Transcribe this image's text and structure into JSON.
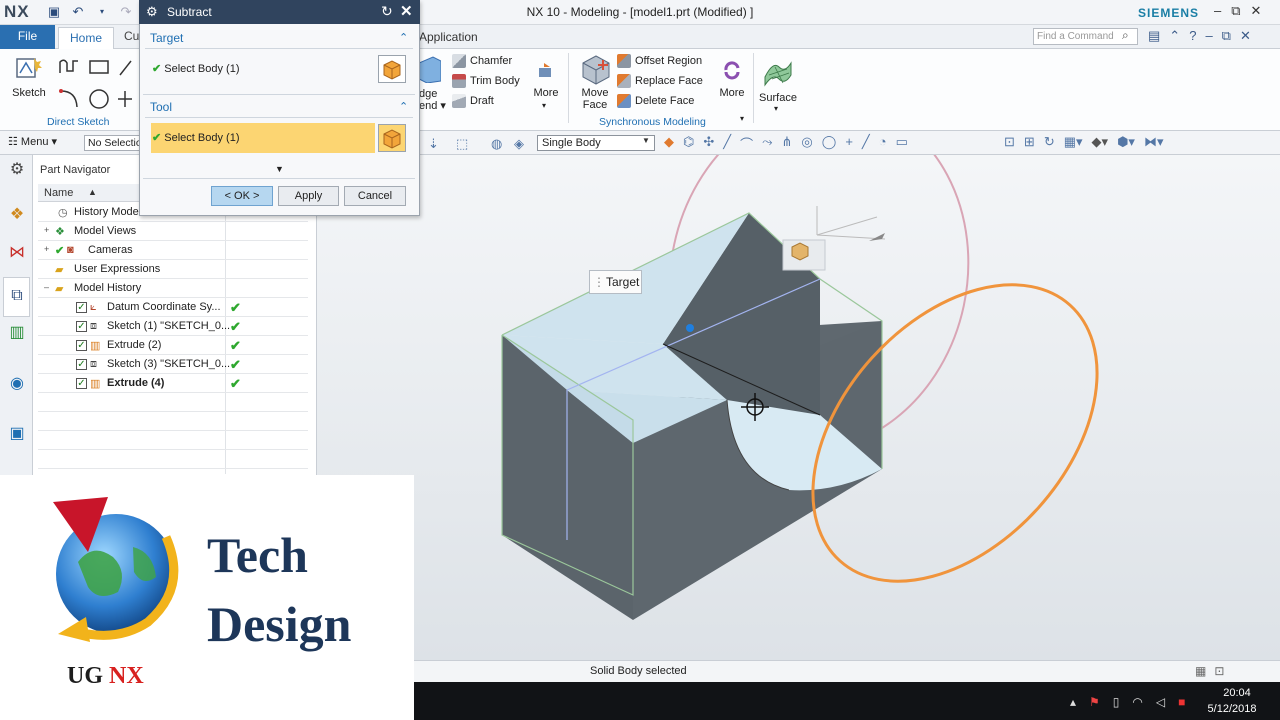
{
  "window": {
    "app_logo": "NX",
    "title": "NX 10 - Modeling - [model1.prt (Modified) ]",
    "brand": "SIEMENS",
    "controls": [
      "–",
      "⧉",
      "✕"
    ]
  },
  "tabs": {
    "file": "File",
    "home": "Home",
    "partial": "Cu",
    "application": "Application",
    "find_placeholder": "Find a Command"
  },
  "ribbon": {
    "sketch_label": "Sketch",
    "direct_sketch_group": "Direct Sketch",
    "edge_blend_partial": "dge\nend",
    "edge_line1": "dge",
    "edge_line2": "end",
    "chamfer": "Chamfer",
    "trim_body": "Trim Body",
    "draft": "Draft",
    "more1": "More",
    "move_face_line1": "Move",
    "move_face_line2": "Face",
    "offset_region": "Offset Region",
    "replace_face": "Replace Face",
    "delete_face": "Delete Face",
    "more2": "More",
    "synchronous_group": "Synchronous Modeling",
    "surface": "Surface"
  },
  "cmdbar": {
    "menu": "Menu",
    "selection_filter": "No Selectio",
    "body_filter": "Single Body"
  },
  "navigator": {
    "title": "Part Navigator",
    "column_name": "Name",
    "rows": [
      {
        "label": "History Mode"
      },
      {
        "label": "Model Views"
      },
      {
        "label": "Cameras"
      },
      {
        "label": "User Expressions"
      },
      {
        "label": "Model History"
      },
      {
        "label": "Datum Coordinate Sy..."
      },
      {
        "label": "Sketch (1) \"SKETCH_0..."
      },
      {
        "label": "Extrude (2)"
      },
      {
        "label": "Sketch (3) \"SKETCH_0..."
      },
      {
        "label": "Extrude (4)"
      }
    ]
  },
  "dialog": {
    "title": "Subtract",
    "target_section": "Target",
    "target_select": "Select Body (1)",
    "tool_section": "Tool",
    "tool_select": "Select Body (1)",
    "ok": "< OK >",
    "apply": "Apply",
    "cancel": "Cancel"
  },
  "viewport": {
    "target_tag": "Target"
  },
  "status": {
    "message": "Solid Body selected"
  },
  "taskbar": {
    "time": "20:04",
    "date": "5/12/2018"
  },
  "overlay": {
    "tech": "Tech",
    "design": "Design",
    "ug": "UG",
    "nx": "NX"
  },
  "colors": {
    "accent": "#2a6fb1",
    "dialog_title": "#30445e",
    "selection_highlight": "#fcd572",
    "orange_circle": "#f0943c",
    "pink_circle": "#d9a5b5",
    "body_top": "#cfe3ee",
    "body_side": "#5b646b"
  }
}
